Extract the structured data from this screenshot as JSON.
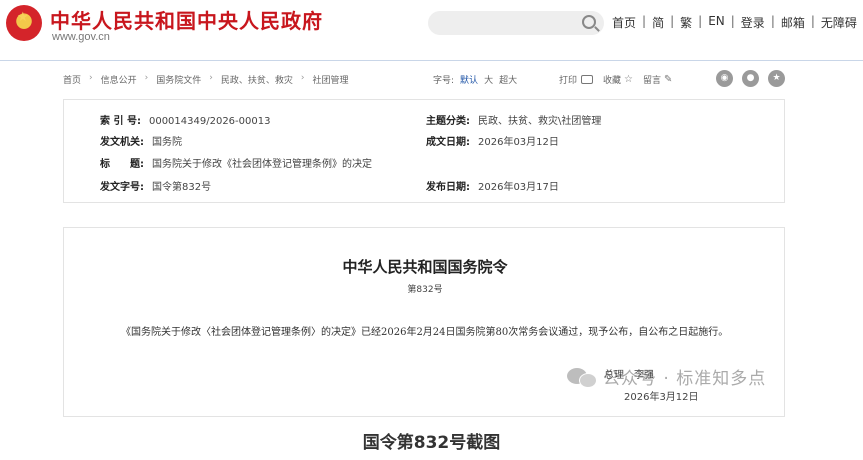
{
  "header": {
    "site_title": "中华人民共和国中央人民政府",
    "site_url": "www.gov.cn",
    "links": [
      "首页",
      "简",
      "繁",
      "EN",
      "登录",
      "邮箱",
      "无障碍"
    ]
  },
  "breadcrumb": [
    "首页",
    "信息公开",
    "国务院文件",
    "民政、扶贫、救灾",
    "社团管理"
  ],
  "font_size": {
    "label": "字号:",
    "options": [
      "默认",
      "大",
      "超大"
    ],
    "selected": "默认"
  },
  "actions": {
    "print": "打印",
    "favorite": "收藏",
    "comment": "留言"
  },
  "share_icons": [
    "weibo-icon",
    "wechat-icon",
    "star-share-icon"
  ],
  "info": {
    "index_label": "索 引 号:",
    "index_value": "000014349/2026-00013",
    "category_label": "主题分类:",
    "category_value": "民政、扶贫、救灾\\社团管理",
    "issuer_label": "发文机关:",
    "issuer_value": "国务院",
    "written_label": "成文日期:",
    "written_value": "2026年03月12日",
    "title_label": "标　　题:",
    "title_value": "国务院关于修改《社会团体登记管理条例》的决定",
    "docno_label": "发文字号:",
    "docno_value": "国令第832号",
    "published_label": "发布日期:",
    "published_value": "2026年03月17日"
  },
  "document": {
    "title": "中华人民共和国国务院令",
    "number": "第832号",
    "body": "《国务院关于修改〈社会团体登记管理条例〉的决定》已经2026年2月24日国务院第80次常务会议通过，现予公布，自公布之日起施行。",
    "signature": "总理　李强",
    "date": "2026年3月12日"
  },
  "watermark": "公众号 · 标准知多点",
  "caption": "国令第832号截图",
  "colors": {
    "brand_red": "#c8161d",
    "link_blue": "#2357a8"
  }
}
